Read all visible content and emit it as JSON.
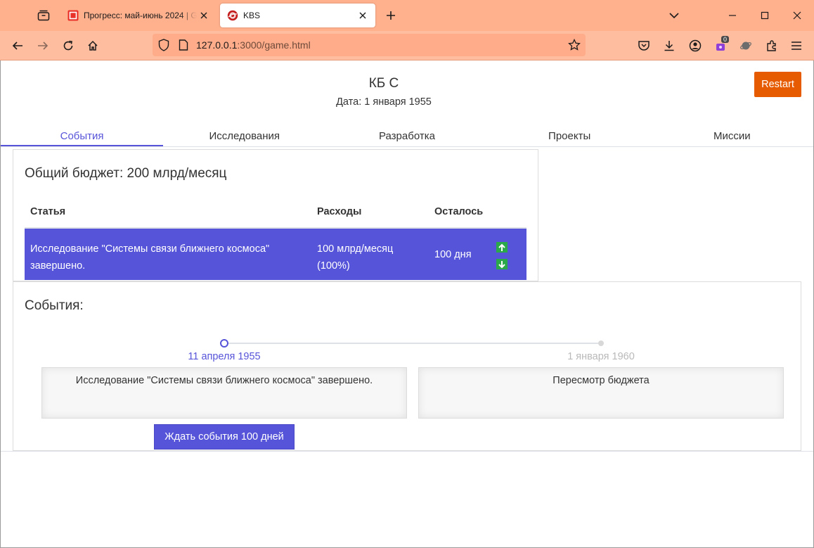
{
  "browser": {
    "tabs": [
      {
        "title": "Прогресс: май-июнь 2024 | GameDev",
        "active": false
      },
      {
        "title": "KBS",
        "active": true
      }
    ],
    "url_host": "127.0.0.1",
    "url_rest": ":3000/game.html",
    "extension_badge": "0",
    "colors": {
      "chrome_tabbar": "#ffb08d",
      "chrome_navbar": "#ffbd9f",
      "urlbar": "#ffac8a"
    }
  },
  "header": {
    "title": "КБ С",
    "date": "Дата: 1 января 1955",
    "restart_label": "Restart"
  },
  "nav_tabs": [
    {
      "label": "События",
      "active": true
    },
    {
      "label": "Исследования",
      "active": false
    },
    {
      "label": "Разработка",
      "active": false
    },
    {
      "label": "Проекты",
      "active": false
    },
    {
      "label": "Миссии",
      "active": false
    }
  ],
  "budget": {
    "title": "Общий бюджет: 200 млрд/месяц",
    "columns": [
      "Статья",
      "Расходы",
      "Осталось"
    ],
    "rows": [
      {
        "item": "Исследование \"Системы связи ближнего космоса\" завершено.",
        "cost": "100 млрд/месяц (100%)",
        "remaining": "100 дня"
      }
    ]
  },
  "events": {
    "title": "События:",
    "timeline": [
      {
        "date": "11 апреля 1955",
        "text": "Исследование \"Системы связи ближнего космоса\" завершено.",
        "active": true
      },
      {
        "date": "1 января 1960",
        "text": "Пересмотр бюджета",
        "active": false
      }
    ],
    "wait_label": "Ждать события 100 дней"
  },
  "colors": {
    "accent": "#5654d8",
    "restart": "#e75b00",
    "arrow_green": "#2aa84a"
  }
}
